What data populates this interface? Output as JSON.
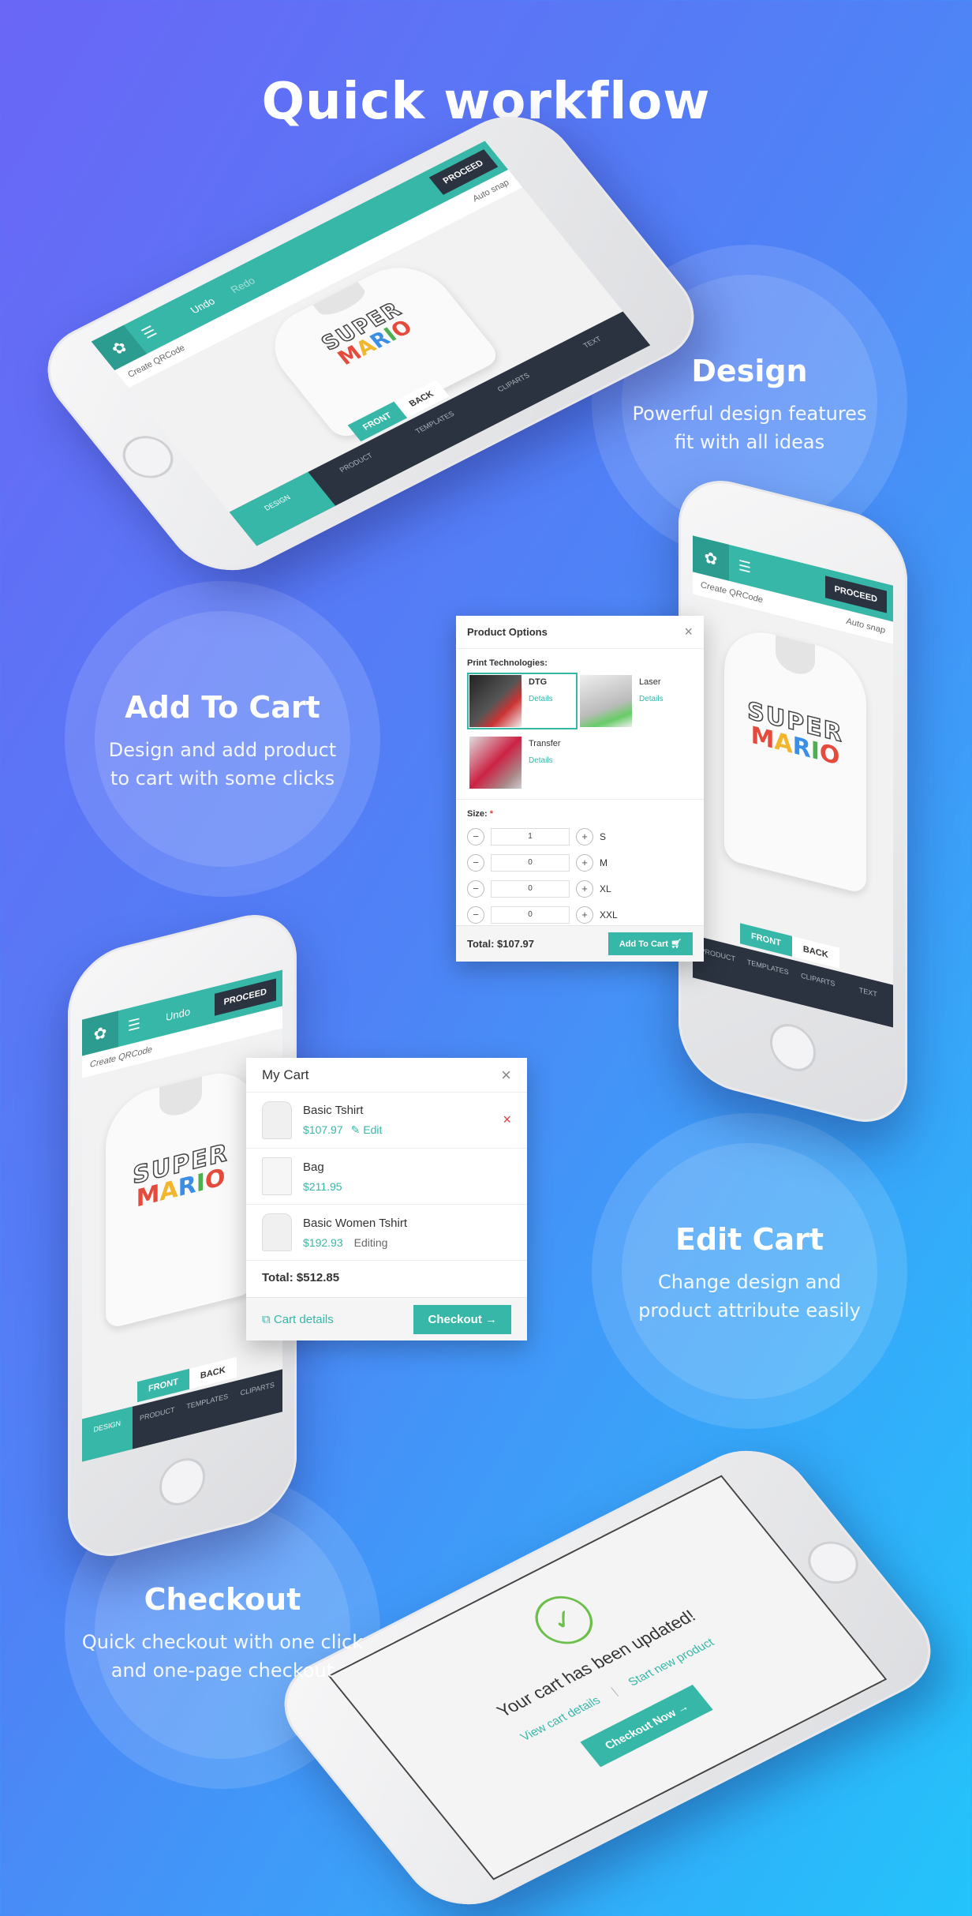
{
  "heading": "Quick workflow",
  "features": {
    "design": {
      "title": "Design",
      "desc1": "Powerful design features",
      "desc2": "fit with all ideas"
    },
    "add_to_cart": {
      "title": "Add To Cart",
      "desc1": "Design and add product",
      "desc2": "to cart with some clicks"
    },
    "edit_cart": {
      "title": "Edit Cart",
      "desc1": "Change design and",
      "desc2": "product attribute easily"
    },
    "checkout": {
      "title": "Checkout",
      "desc1": "Quick checkout with one click",
      "desc2": "and one-page checkout"
    }
  },
  "editor": {
    "undo": "Undo",
    "redo": "Redo",
    "proceed": "PROCEED",
    "create_qr": "Create QRCode",
    "auto_snap": "Auto snap",
    "front": "FRONT",
    "back": "BACK",
    "mario_top": "SUPER",
    "mario_letters": [
      "M",
      "A",
      "R",
      "I",
      "O"
    ],
    "nav": [
      "DESIGN",
      "PRODUCT",
      "TEMPLATES",
      "CLIPARTS",
      "TEXT"
    ]
  },
  "product_options": {
    "title": "Product Options",
    "close": "×",
    "print_tech_label": "Print Technologies:",
    "technologies": [
      {
        "name": "DTG",
        "link": "Details",
        "selected": true
      },
      {
        "name": "Laser",
        "link": "Details",
        "selected": false
      },
      {
        "name": "Transfer",
        "link": "Details",
        "selected": false
      }
    ],
    "size_label": "Size:",
    "required_mark": "*",
    "sizes": [
      {
        "qty": "1",
        "size": "S"
      },
      {
        "qty": "0",
        "size": "M"
      },
      {
        "qty": "0",
        "size": "XL"
      },
      {
        "qty": "0",
        "size": "XXL"
      }
    ],
    "minus": "−",
    "plus": "+",
    "total": "Total: $107.97",
    "add_to_cart": "Add To Cart"
  },
  "cart": {
    "title": "My Cart",
    "close": "×",
    "items": [
      {
        "name": "Basic Tshirt",
        "price": "$107.97",
        "action": "Edit"
      },
      {
        "name": "Bag",
        "price": "$211.95",
        "action": ""
      },
      {
        "name": "Basic Women Tshirt",
        "price": "$192.93",
        "action": "Editing"
      }
    ],
    "remove": "×",
    "total": "Total: $512.85",
    "details": "Cart details",
    "checkout": "Checkout"
  },
  "checkout_screen": {
    "message": "Your cart has been updated!",
    "view_cart": "View cart details",
    "start_new": "Start new product",
    "checkout_now": "Checkout Now"
  },
  "colors": {
    "accent": "#37b7a8",
    "dark_bar": "#2b3340",
    "bg_start": "#6a66f6",
    "bg_end": "#23c4fb",
    "danger": "#e23b3b"
  }
}
